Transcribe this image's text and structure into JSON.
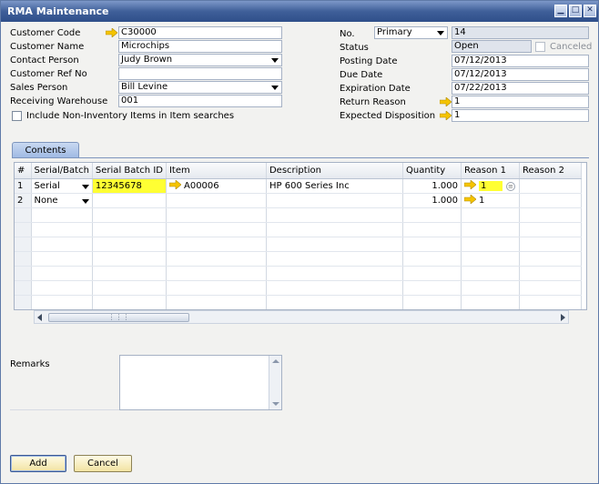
{
  "window": {
    "title": "RMA Maintenance"
  },
  "left_fields": {
    "customer_code": {
      "label": "Customer Code",
      "value": "C30000"
    },
    "customer_name": {
      "label": "Customer Name",
      "value": "Microchips"
    },
    "contact_person": {
      "label": "Contact Person",
      "value": "Judy Brown"
    },
    "customer_ref_no": {
      "label": "Customer Ref No",
      "value": ""
    },
    "sales_person": {
      "label": "Sales Person",
      "value": "Bill Levine"
    },
    "receiving_warehouse": {
      "label": "Receiving Warehouse",
      "value": "001"
    },
    "include_non_inventory": {
      "label": "Include Non-Inventory Items in Item searches",
      "checked": false
    }
  },
  "right_fields": {
    "no": {
      "label": "No.",
      "series": "Primary",
      "value": "14"
    },
    "status": {
      "label": "Status",
      "value": "Open",
      "canceled_label": "Canceled",
      "canceled_checked": false
    },
    "posting_date": {
      "label": "Posting Date",
      "value": "07/12/2013"
    },
    "due_date": {
      "label": "Due Date",
      "value": "07/12/2013"
    },
    "expiration_date": {
      "label": "Expiration Date",
      "value": "07/22/2013"
    },
    "return_reason": {
      "label": "Return Reason",
      "value": "1"
    },
    "expected_disposition": {
      "label": "Expected Disposition",
      "value": "1"
    }
  },
  "tabs": [
    {
      "label": "Contents"
    }
  ],
  "grid": {
    "columns": [
      "#",
      "Serial/Batch",
      "Serial Batch ID",
      "Item",
      "Description",
      "Quantity",
      "Reason 1",
      "Reason 2"
    ],
    "rows": [
      {
        "num": "1",
        "serial_batch": "Serial",
        "serial_batch_id": "12345678",
        "item": "A00006",
        "description": "HP 600 Series Inc",
        "quantity": "1.000",
        "reason1": "1",
        "reason2": ""
      },
      {
        "num": "2",
        "serial_batch": "None",
        "serial_batch_id": "",
        "item": "",
        "description": "",
        "quantity": "1.000",
        "reason1": "1",
        "reason2": ""
      }
    ]
  },
  "remarks": {
    "label": "Remarks",
    "value": ""
  },
  "buttons": {
    "add": "Add",
    "cancel": "Cancel"
  },
  "colors": {
    "titlebar": "#3f5f99",
    "highlight": "#ffff33",
    "link_arrow": "#f5c400"
  }
}
